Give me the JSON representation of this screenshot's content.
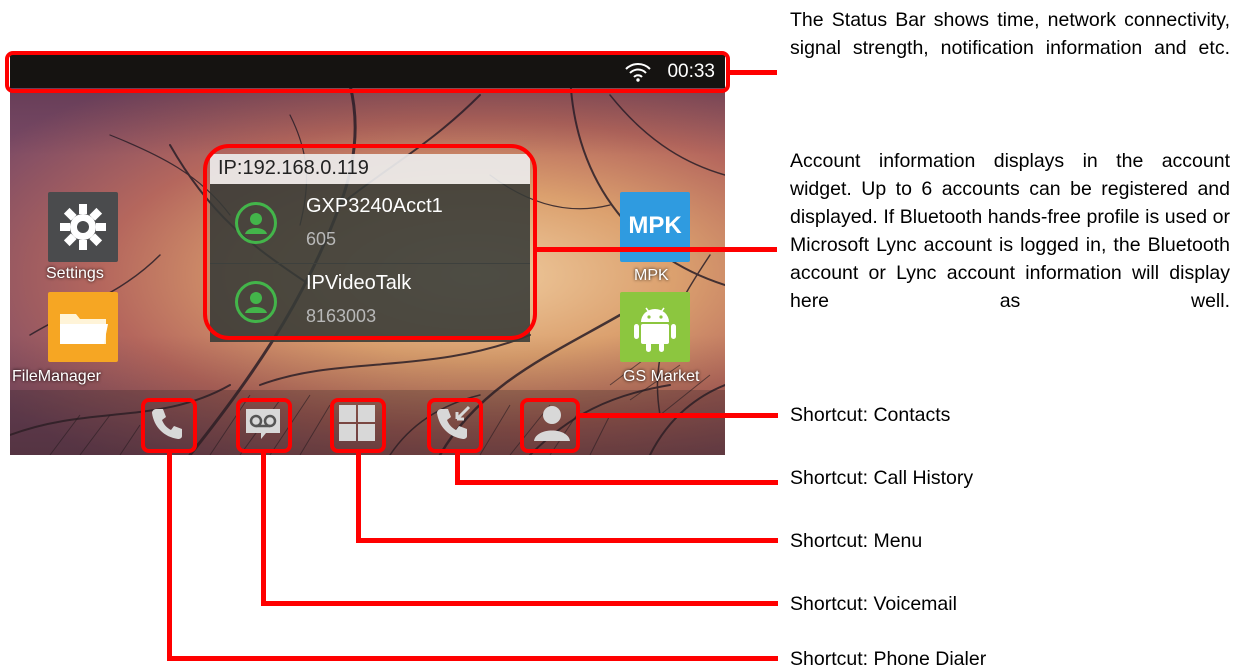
{
  "status_bar": {
    "time": "00:33",
    "icon": "wifi-icon"
  },
  "account_widget": {
    "ip": "IP:192.168.0.119",
    "accounts": [
      {
        "name": "GXP3240Acct1",
        "number": "605"
      },
      {
        "name": "IPVideoTalk",
        "number": "8163003"
      }
    ]
  },
  "apps": {
    "settings": "Settings",
    "filemanager": "FileManager",
    "mpk": "MPK",
    "mpk_icon_text": "MPK",
    "gsmarket": "GS Market"
  },
  "dock": [
    "phone-icon",
    "voicemail-icon",
    "menu-icon",
    "call-history-icon",
    "contacts-icon"
  ],
  "descriptions": {
    "status_bar": "The Status Bar shows time, network connectivity, signal strength, notification information and etc.",
    "account_widget": "Account information displays in the account widget. Up to 6 accounts can be registered and displayed. If Bluetooth hands-free profile is used or Microsoft Lync account is logged in, the Bluetooth account or Lync account information will display here as well."
  },
  "callouts": {
    "contacts": "Shortcut: Contacts",
    "call_history": "Shortcut: Call History",
    "menu": "Shortcut: Menu",
    "voicemail": "Shortcut: Voicemail",
    "phone_dialer": "Shortcut: Phone Dialer"
  },
  "colors": {
    "callout_red": "#ff0000",
    "account_green": "#43b54a",
    "mpk_blue": "#2f9be0",
    "android_green": "#8cc63f",
    "folder_orange": "#f6a623"
  }
}
